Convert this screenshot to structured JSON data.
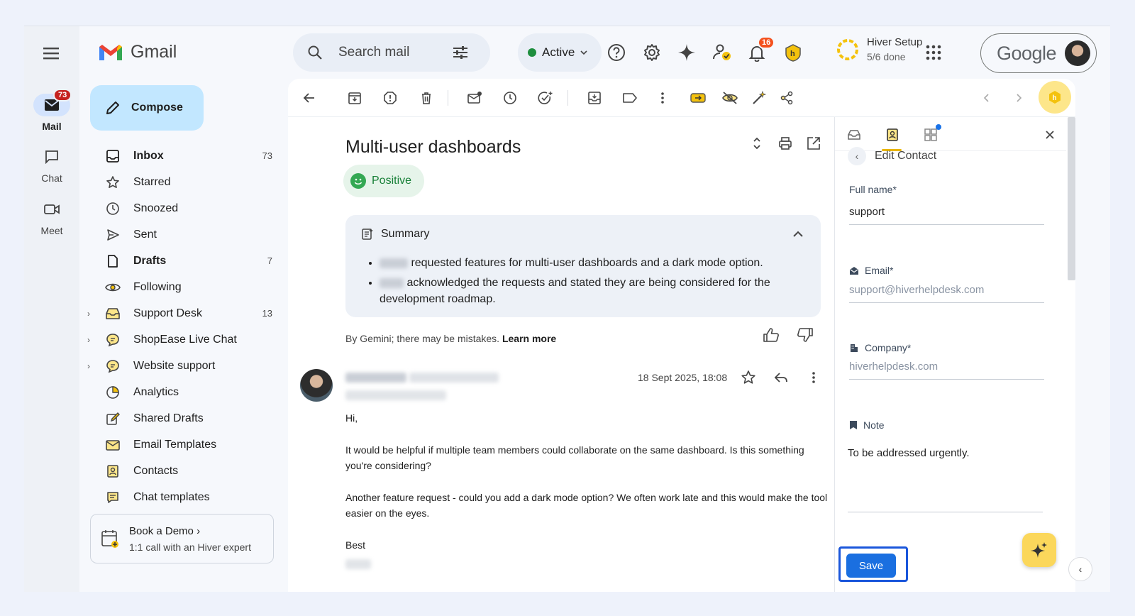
{
  "rail": {
    "items": [
      {
        "label": "Mail",
        "badge": "73"
      },
      {
        "label": "Chat"
      },
      {
        "label": "Meet"
      }
    ]
  },
  "app": {
    "name": "Gmail"
  },
  "search": {
    "placeholder": "Search mail"
  },
  "status": {
    "label": "Active",
    "color": "#1e8e3e"
  },
  "notifications": {
    "count": "16"
  },
  "hiver_setup": {
    "title": "Hiver Setup",
    "progress": "5/6 done"
  },
  "account": {
    "brand": "Google"
  },
  "compose": {
    "label": "Compose"
  },
  "nav": {
    "items": [
      {
        "label": "Inbox",
        "count": "73",
        "bold": true,
        "icon": "inbox-icon"
      },
      {
        "label": "Starred",
        "icon": "star-icon"
      },
      {
        "label": "Snoozed",
        "icon": "clock-icon"
      },
      {
        "label": "Sent",
        "icon": "send-icon"
      },
      {
        "label": "Drafts",
        "count": "7",
        "bold": true,
        "icon": "draft-icon"
      },
      {
        "label": "Following",
        "icon": "eye-icon"
      },
      {
        "label": "Support Desk",
        "count": "13",
        "icon": "shared-inbox-icon"
      },
      {
        "label": "ShopEase Live Chat",
        "icon": "chat-bubble-icon"
      },
      {
        "label": "Website support",
        "icon": "chat-bubble-icon"
      },
      {
        "label": "Analytics",
        "icon": "pie-chart-icon"
      },
      {
        "label": "Shared Drafts",
        "icon": "edit-icon"
      },
      {
        "label": "Email Templates",
        "icon": "template-icon"
      },
      {
        "label": "Contacts",
        "icon": "contact-card-icon"
      },
      {
        "label": "Chat templates",
        "icon": "chat-template-icon"
      }
    ]
  },
  "demo": {
    "title": "Book a Demo",
    "subtitle": "1:1 call with an Hiver expert"
  },
  "email": {
    "subject": "Multi-user dashboards",
    "sentiment": "Positive",
    "summary": {
      "title": "Summary",
      "bullets": [
        "requested features for multi-user dashboards and a dark mode option.",
        "acknowledged the requests and stated they are being considered for the development roadmap."
      ]
    },
    "gemini_note": "By Gemini; there may be mistakes.",
    "learn_more": "Learn more",
    "date": "18 Sept 2025, 18:08",
    "body": [
      "Hi,",
      "It would be helpful if multiple team members could collaborate on the same dashboard. Is this something you're considering?",
      "Another feature request - could you add a dark mode option? We often work late and this would make the tool easier on the eyes.",
      "Best"
    ]
  },
  "panel": {
    "back_label": "Edit Contact",
    "full_name_label": "Full name*",
    "full_name_value": "support",
    "email_label": "Email*",
    "email_placeholder": "support@hiverhelpdesk.com",
    "company_label": "Company*",
    "company_placeholder": "hiverhelpdesk.com",
    "note_label": "Note",
    "note_value": "To be addressed urgently.",
    "save_label": "Save"
  }
}
